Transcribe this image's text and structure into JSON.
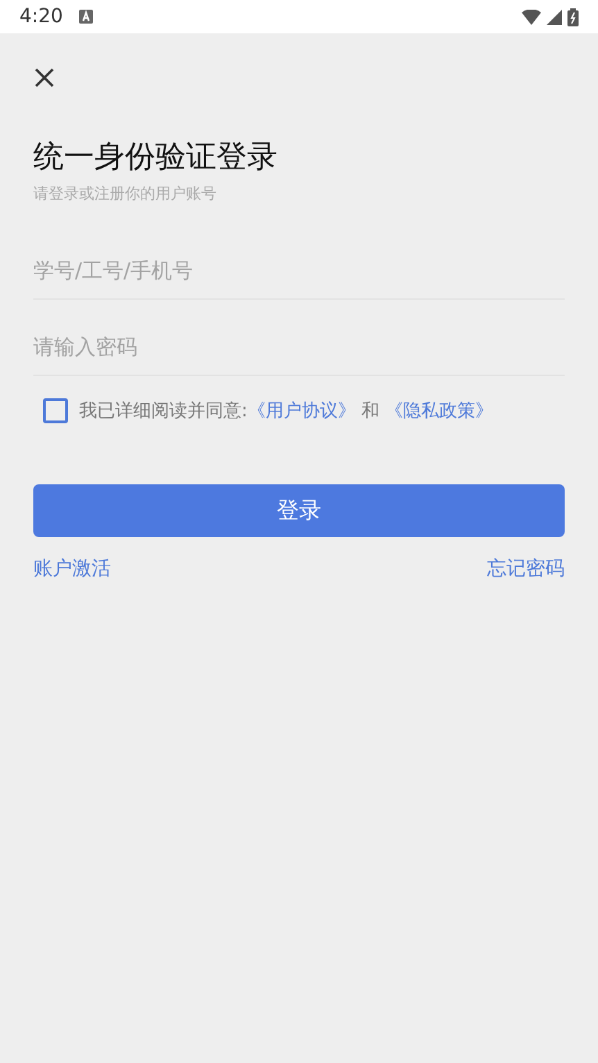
{
  "status_bar": {
    "time": "4:20"
  },
  "title": "统一身份验证登录",
  "subtitle": "请登录或注册你的用户账号",
  "fields": [
    {
      "placeholder": "学号/工号/手机号"
    },
    {
      "placeholder": "请输入密码"
    }
  ],
  "agreement": {
    "checked": false,
    "text": "我已详细阅读并同意:",
    "link_1": "《用户协议》",
    "joiner": "和",
    "link_2": "《隐私政策》"
  },
  "login_button": "登录",
  "links": [
    "账户激活",
    "忘记密码"
  ]
}
